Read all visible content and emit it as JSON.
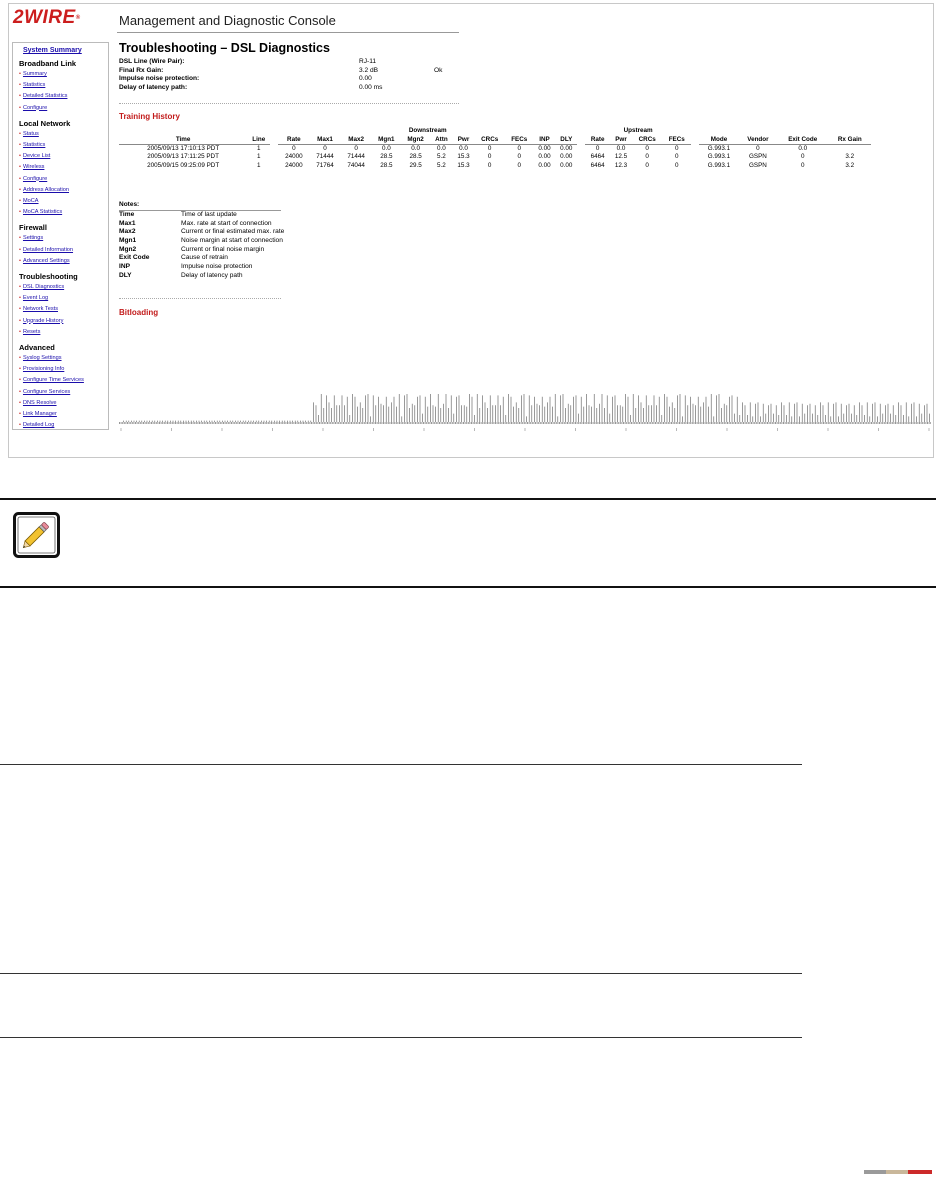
{
  "logo": {
    "text": "2WIRE",
    "tm": "®"
  },
  "console_title": "Management and Diagnostic Console",
  "sidebar": {
    "top_link": "System Summary",
    "sections": [
      {
        "title": "Broadband Link",
        "items": [
          "Summary",
          "Statistics",
          "Detailed Statistics",
          "Configure"
        ]
      },
      {
        "title": "Local Network",
        "items": [
          "Status",
          "Statistics",
          "Device List",
          "Wireless",
          "Configure",
          "Address Allocation",
          "MoCA",
          "MoCA Statistics"
        ]
      },
      {
        "title": "Firewall",
        "items": [
          "Settings",
          "Detailed Information",
          "Advanced Settings"
        ]
      },
      {
        "title": "Troubleshooting",
        "items": [
          "DSL Diagnostics",
          "Event Log",
          "Network Tests",
          "Upgrade History",
          "Resets"
        ]
      },
      {
        "title": "Advanced",
        "items": [
          "Syslog Settings",
          "Provisioning Info",
          "Configure Time Services",
          "Configure Services",
          "DNS Resolve",
          "Link Manager",
          "Detailed Log"
        ]
      }
    ]
  },
  "page_title": "Troubleshooting – DSL Diagnostics",
  "summary": [
    {
      "label": "DSL Line (Wire Pair):",
      "value": "RJ-11",
      "status": ""
    },
    {
      "label": "Final Rx Gain:",
      "value": "3.2 dB",
      "status": "Ok"
    },
    {
      "label": "Impulse noise protection:",
      "value": "0.00",
      "status": ""
    },
    {
      "label": "Delay of latency path:",
      "value": "0.00 ms",
      "status": ""
    }
  ],
  "training_history": {
    "title": "Training History",
    "group_downstream": "Downstream",
    "group_upstream": "Upstream",
    "columns": [
      "Time",
      "Line",
      "Rate",
      "Max1",
      "Max2",
      "Mgn1",
      "Mgn2",
      "Attn",
      "Pwr",
      "CRCs",
      "FECs",
      "INP",
      "DLY",
      "Rate",
      "Pwr",
      "CRCs",
      "FECs",
      "Mode",
      "Vendor",
      "Exit Code",
      "Rx Gain"
    ],
    "rows": [
      [
        "2005/09/13 17:10:13 PDT",
        "1",
        "0",
        "0",
        "0",
        "0.0",
        "0.0",
        "0.0",
        "0.0",
        "0",
        "0",
        "0.00",
        "0.00",
        "0",
        "0.0",
        "0",
        "0",
        "G.993.1",
        "0",
        "0.0",
        ""
      ],
      [
        "2005/09/13 17:11:25 PDT",
        "1",
        "24000",
        "71444",
        "71444",
        "28.5",
        "28.5",
        "5.2",
        "15.3",
        "0",
        "0",
        "0.00",
        "0.00",
        "6464",
        "12.5",
        "0",
        "0",
        "G.993.1",
        "GSPN",
        "0",
        "3.2"
      ],
      [
        "2005/09/15 09:25:09 PDT",
        "1",
        "24000",
        "71764",
        "74044",
        "28.5",
        "29.5",
        "5.2",
        "15.3",
        "0",
        "0",
        "0.00",
        "0.00",
        "6464",
        "12.3",
        "0",
        "0",
        "G.993.1",
        "GSPN",
        "0",
        "3.2"
      ]
    ]
  },
  "notes": {
    "label": "Notes:",
    "items": [
      {
        "key": "Time",
        "desc": "Time of last update"
      },
      {
        "key": "Max1",
        "desc": "Max. rate at start of connection"
      },
      {
        "key": "Max2",
        "desc": "Current or final estimated max. rate"
      },
      {
        "key": "Mgn1",
        "desc": "Noise margin at start of connection"
      },
      {
        "key": "Mgn2",
        "desc": "Current or final noise margin"
      },
      {
        "key": "Exit Code",
        "desc": "Cause of retrain"
      },
      {
        "key": "INP",
        "desc": "Impulse noise protection"
      },
      {
        "key": "DLY",
        "desc": "Delay of latency path"
      }
    ]
  },
  "bitloading": {
    "title": "Bitloading"
  },
  "icons": {
    "note": "pencil-icon"
  },
  "colors": {
    "brand_red": "#cc1e1e",
    "section_red": "#c21b1b",
    "link_blue": "#1a0dab"
  }
}
